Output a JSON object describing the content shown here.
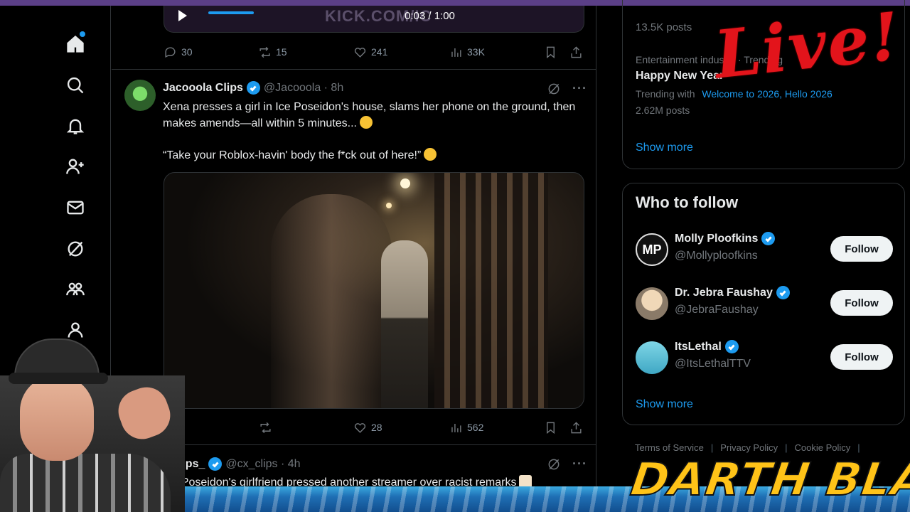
{
  "nav": {
    "items": [
      "home-icon",
      "search-icon",
      "notifications-icon",
      "follow-icon",
      "messages-icon",
      "grok-icon",
      "communities-icon",
      "profile-icon"
    ]
  },
  "prev_tweet": {
    "video_time": "0:03 / 1:00",
    "video_text": "KICK.COM/IC",
    "actions": {
      "replies": "30",
      "reposts": "15",
      "likes": "241",
      "views": "33K"
    }
  },
  "tweet1": {
    "name": "Jacooola Clips",
    "handle": "@Jacooola · 8h",
    "text_line1": "Xena presses a girl in Ice Poseidon's house, slams her phone on the ground, then makes amends—all within 5 minutes...",
    "text_line2": "“Take your Roblox-havin' body the f*ck out of here!”",
    "actions": {
      "reposts": "",
      "likes": "28",
      "views": "562"
    }
  },
  "tweet2": {
    "name": "clips_",
    "handle": "@cx_clips · 4h",
    "text": "Ice Poseidon's girlfriend pressed another streamer over racist remarks"
  },
  "trends": {
    "top_posts": "13.5K posts",
    "category": "Entertainment industry · Trending",
    "title": "Happy New Year",
    "trending_with_label": "Trending with",
    "trending_with_links": "Welcome to 2026, Hello 2026",
    "posts": "2.62M posts",
    "show_more": "Show more"
  },
  "who_to_follow": {
    "title": "Who to follow",
    "users": [
      {
        "name": "Molly Ploofkins",
        "handle": "@Mollyploofkins",
        "button": "Follow"
      },
      {
        "name": "Dr. Jebra Faushay",
        "handle": "@JebraFaushay",
        "button": "Follow"
      },
      {
        "name": "ItsLethal",
        "handle": "@ItsLethalTTV",
        "button": "Follow"
      }
    ],
    "show_more": "Show more"
  },
  "footer": {
    "links": [
      "Terms of Service",
      "Privacy Policy",
      "Cookie Policy"
    ]
  },
  "overlays": {
    "live": "Live!",
    "brand": "DARTH BLAZE"
  },
  "colors": {
    "accent": "#1d9bf0",
    "background": "#000000",
    "live_red": "#e3141b",
    "brand_yellow": "#ffc318"
  }
}
